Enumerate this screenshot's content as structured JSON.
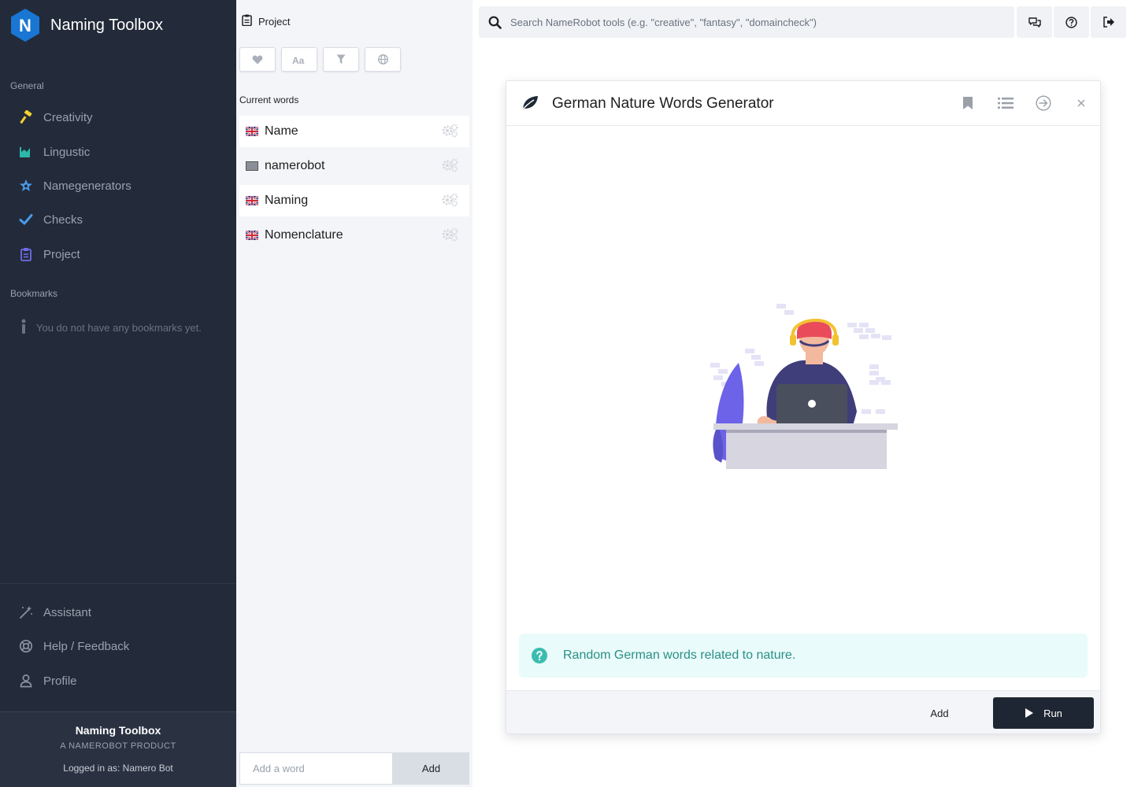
{
  "app": {
    "name": "Naming Toolbox",
    "logo_letter": "N"
  },
  "sidebar": {
    "general_title": "General",
    "nav": [
      {
        "label": "Creativity",
        "icon": "hammer-icon"
      },
      {
        "label": "Lingustic",
        "icon": "chart-icon"
      },
      {
        "label": "Namegenerators",
        "icon": "star-badge-icon"
      },
      {
        "label": "Checks",
        "icon": "check-icon"
      },
      {
        "label": "Project",
        "icon": "clipboard-icon"
      }
    ],
    "bookmarks_title": "Bookmarks",
    "bookmarks_empty": "You do not have any bookmarks yet.",
    "bottom_nav": [
      {
        "label": "Assistant",
        "icon": "magic-wand-icon"
      },
      {
        "label": "Help / Feedback",
        "icon": "lifebuoy-icon"
      },
      {
        "label": "Profile",
        "icon": "user-icon"
      }
    ],
    "footer": {
      "title": "Naming Toolbox",
      "subtitle": "A NAMEROBOT PRODUCT",
      "logged_in": "Logged in as: Namero Bot"
    }
  },
  "project": {
    "title": "Project",
    "current_words_label": "Current words",
    "words": [
      {
        "text": "Name",
        "flag": "uk-flag"
      },
      {
        "text": "namerobot",
        "flag": "neutral-flag"
      },
      {
        "text": "Naming",
        "flag": "uk-flag"
      },
      {
        "text": "Nomenclature",
        "flag": "uk-flag"
      }
    ],
    "add_placeholder": "Add a word",
    "add_button": "Add"
  },
  "search": {
    "placeholder": "Search NameRobot tools (e.g. \"creative\", \"fantasy\", \"domaincheck\")"
  },
  "generator": {
    "title": "German Nature Words Generator",
    "description": "Random German words related to nature.",
    "add_label": "Add",
    "run_label": "Run"
  },
  "colors": {
    "sidebar_bg": "#232b3a",
    "logo_blue": "#1976d2",
    "info_bg": "#e9fbfa",
    "info_text": "#2a8f86",
    "run_bg": "#1f2633"
  }
}
